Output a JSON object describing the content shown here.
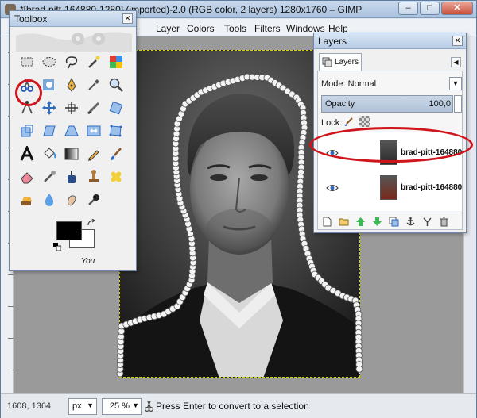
{
  "window": {
    "title": "*[brad-pitt-164880-1280] (imported)-2.0 (RGB color, 2 layers) 1280x1760 – GIMP",
    "minimize": "–",
    "maximize": "□",
    "close": "✕"
  },
  "menubar": {
    "items": [
      "Layer",
      "Colors",
      "Tools",
      "Filters",
      "Windows",
      "Help"
    ]
  },
  "toolbox": {
    "title": "Toolbox",
    "close": "✕",
    "you_label": "You"
  },
  "layers_dialog": {
    "title": "Layers",
    "close": "✕",
    "tab_label": "Layers",
    "tab_menu_arrow": "◀",
    "mode_label": "Mode: Normal",
    "mode_arrow": "▼",
    "opacity_label": "Opacity",
    "opacity_value": "100,0",
    "lock_label": "Lock:",
    "layers": [
      {
        "name": "brad-pitt-164880",
        "thumb": "#2a2a2a",
        "selected": true
      },
      {
        "name": "brad-pitt-164880",
        "thumb": "#7a2a1a",
        "selected": false
      }
    ]
  },
  "statusbar": {
    "coords": "1608, 1364",
    "unit": "px",
    "unit_arrow": "▼",
    "zoom": "25 %",
    "zoom_arrow": "▼",
    "message": "Press Enter to convert to a selection"
  },
  "colors": {
    "highlight": "#d0141b",
    "foreground": "#000000",
    "background": "#ffffff"
  }
}
